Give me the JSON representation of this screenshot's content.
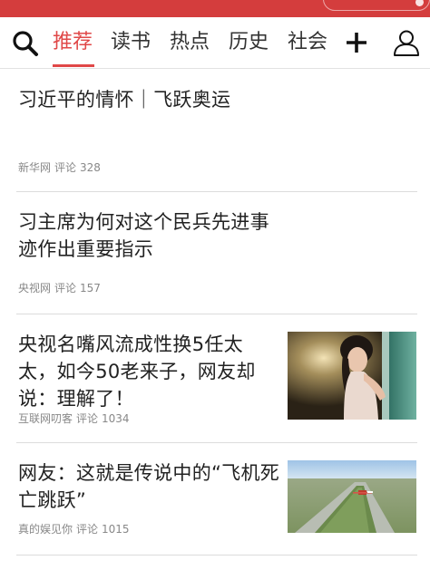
{
  "accent_color": "#e04848",
  "top_bar_color": "#d43d3d",
  "nav": {
    "search_icon": "search-icon",
    "tabs": [
      {
        "label": "推荐",
        "active": true
      },
      {
        "label": "读书",
        "active": false
      },
      {
        "label": "热点",
        "active": false
      },
      {
        "label": "历史",
        "active": false
      },
      {
        "label": "社会",
        "active": false
      }
    ],
    "add_icon": "plus-icon",
    "user_icon": "user-icon"
  },
  "articles": [
    {
      "title": "习近平的情怀｜飞跃奥运",
      "source": "新华网",
      "comment_label": "评论",
      "comments": "328"
    },
    {
      "title": "习主席为何对这个民兵先进事迹作出重要指示",
      "source": "央视网",
      "comment_label": "评论",
      "comments": "157"
    },
    {
      "title": "央视名嘴风流成性换5任太太，如今50老来子，网友却说：理解了！",
      "source": "互联网叨客",
      "comment_label": "评论",
      "comments": "1034",
      "thumbnail": "woman-portrait-image"
    },
    {
      "title": "网友：这就是传说中的“飞机死亡跳跃”",
      "source": "真的娱见你",
      "comment_label": "评论",
      "comments": "1015",
      "thumbnail": "airplane-runway-image"
    }
  ]
}
